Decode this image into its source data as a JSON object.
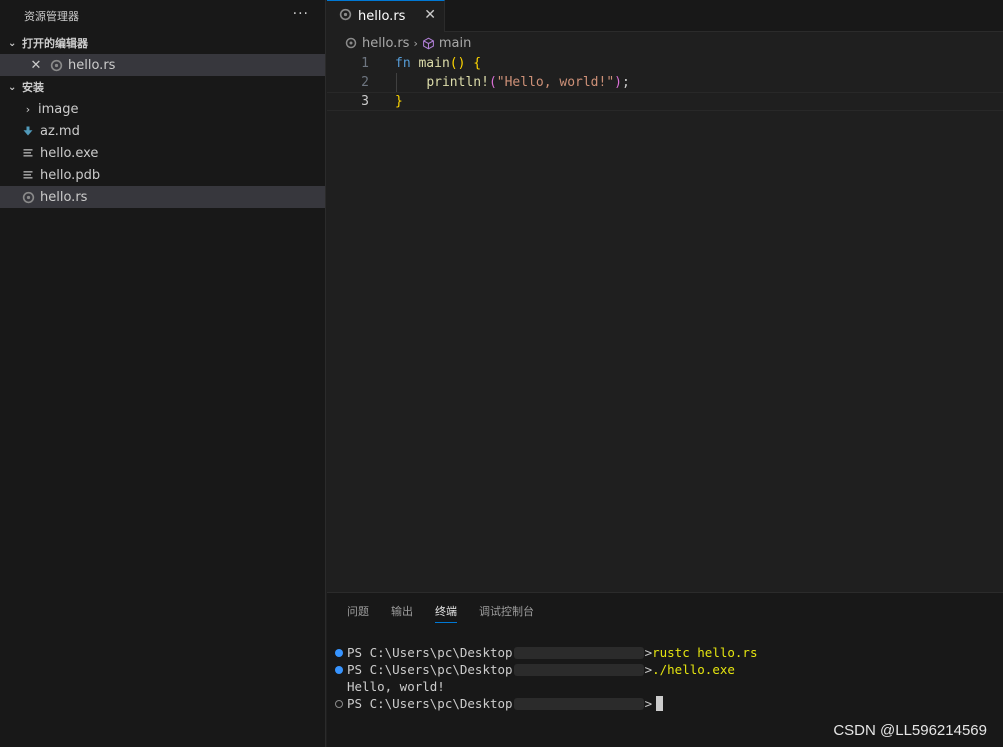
{
  "sidebar": {
    "title": "资源管理器",
    "more": "···",
    "open_editors": {
      "title": "打开的编辑器",
      "items": [
        {
          "label": "hello.rs"
        }
      ]
    },
    "folder": {
      "title": "安装",
      "items": [
        {
          "label": "image"
        },
        {
          "label": "az.md"
        },
        {
          "label": "hello.exe"
        },
        {
          "label": "hello.pdb"
        },
        {
          "label": "hello.rs"
        }
      ]
    }
  },
  "editor": {
    "tab_label": "hello.rs",
    "breadcrumb": {
      "file": "hello.rs",
      "symbol": "main"
    },
    "lines": [
      {
        "num": "1",
        "fn_kw": "fn",
        "fn_name": "main",
        "parens": "()",
        "brace": "{"
      },
      {
        "num": "2",
        "macro": "println!",
        "lparen": "(",
        "string": "\"Hello, world!\"",
        "rparen": ")",
        "semi": ";"
      },
      {
        "num": "3",
        "brace": "}"
      }
    ]
  },
  "panel": {
    "tabs": [
      "问题",
      "输出",
      "终端",
      "调试控制台"
    ],
    "terminal": {
      "prompt": "PS C:\\Users\\pc\\Desktop",
      "prompt_end": ">",
      "cmd1": "rustc hello.rs",
      "cmd2": "./hello.exe",
      "output": "Hello, world!"
    }
  },
  "watermark": "CSDN @LL596214569",
  "colors": {
    "accent": "#0078d4",
    "keyword": "#569cd6",
    "function": "#dcdcaa",
    "string": "#ce9178",
    "command": "#e5e510"
  }
}
